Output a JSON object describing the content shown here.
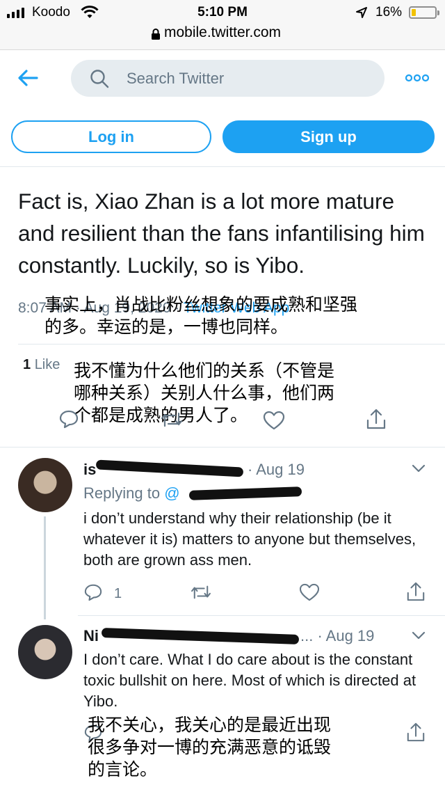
{
  "status_bar": {
    "carrier": "Koodo",
    "time": "5:10 PM",
    "battery": "16%",
    "url": "mobile.twitter.com"
  },
  "header": {
    "search_placeholder": "Search Twitter",
    "login_label": "Log in",
    "signup_label": "Sign up"
  },
  "tweet": {
    "text": "Fact is, Xiao Zhan is a lot more mature and resilient than the fans infantilising him constantly. Luckily, so is Yibo.",
    "time": "8:07 AM · Aug 19, 2020 · ",
    "source": "Twitter Web App",
    "likes_count": "1",
    "likes_label": "Like"
  },
  "captions": {
    "tweet_cn": "事实上，肖战比粉丝想象的要成熟和坚强\n的多。幸运的是，一博也同样。",
    "reply1_cn": "我不懂为什么他们的关系（不管是\n哪种关系）关别人什么事，他们两\n个都是成熟的男人了。",
    "reply2_cn": "我不关心，我关心的是最近出现\n很多争对一博的充满恶意的诋毁\n的言论。"
  },
  "replies": [
    {
      "name": "is",
      "handle_suffix": "· Aug 19",
      "replying_to": "Replying to",
      "replying_at": "@",
      "text": "i don’t understand why their relationship (be it whatever it is) matters to anyone but themselves, both are grown ass men.",
      "reply_count": "1"
    },
    {
      "name": "Ni",
      "handle_suffix": "... · Aug 19",
      "text": "I don’t care. What I do care about is the constant toxic bullshit on here. Most of which is directed at Yibo."
    }
  ],
  "colors": {
    "accent": "#1da1f2",
    "muted": "#657786",
    "text": "#14171a",
    "divider": "#e1e8ed"
  }
}
